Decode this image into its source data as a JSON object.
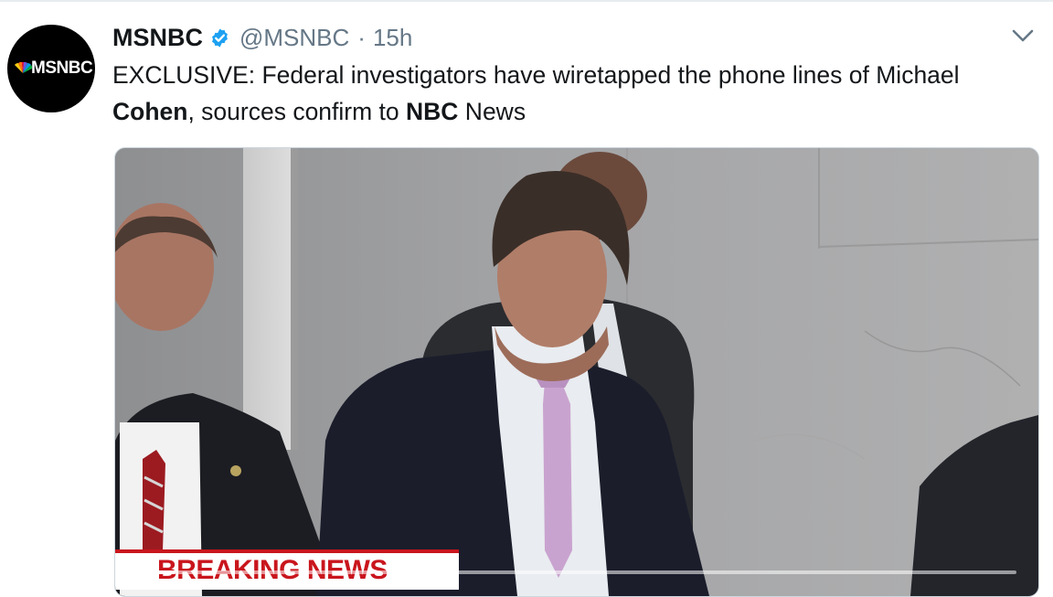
{
  "tweet": {
    "account_name": "MSNBC",
    "handle": "@MSNBC",
    "separator": "·",
    "timestamp": "15h",
    "avatar_label": "MSNBC",
    "text_part1": "EXCLUSIVE: Federal investigators have wiretapped the phone lines of Michael ",
    "text_bold1": "Cohen",
    "text_part2": ", sources confirm to ",
    "text_bold2": "NBC",
    "text_part3": " News"
  },
  "media": {
    "banner_text": "BREAKING NEWS",
    "progress_fraction": 0.04
  },
  "icons": {
    "verified": "verified-badge-icon",
    "caret": "chevron-down-icon"
  },
  "colors": {
    "verified_blue": "#1da1f2",
    "breaking_red": "#c9161d",
    "secondary_text": "#657786"
  }
}
